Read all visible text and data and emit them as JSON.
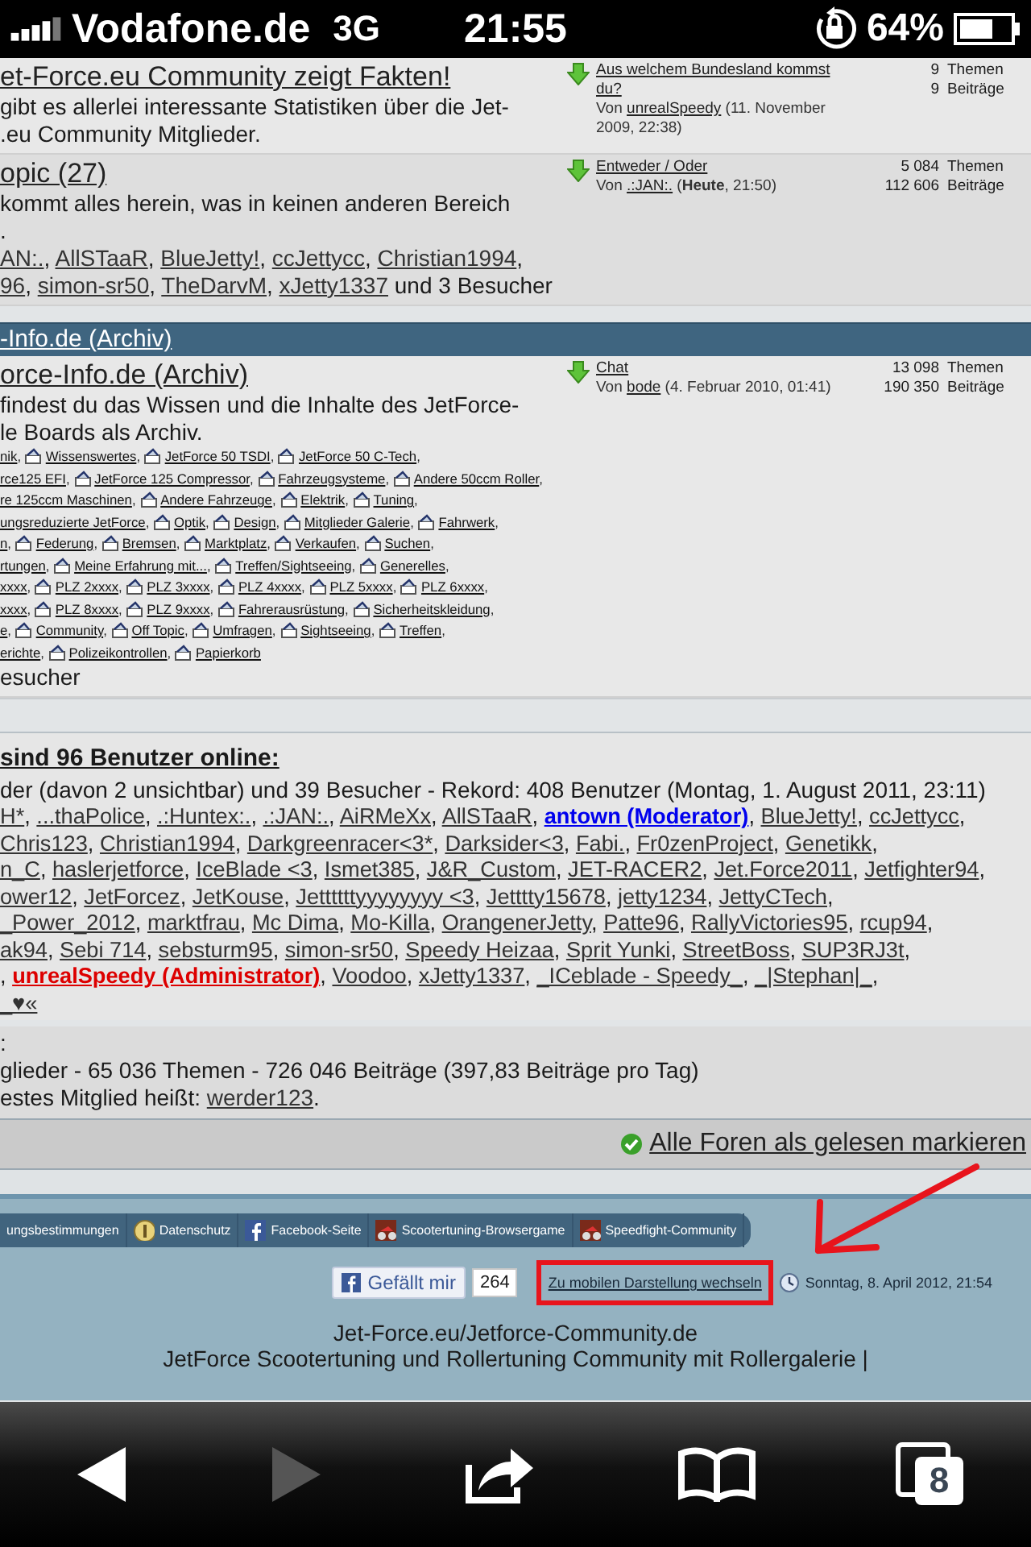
{
  "status_bar": {
    "carrier": "Vodafone.de",
    "network": "3G",
    "time": "21:55",
    "battery": "64%"
  },
  "forums_top": [
    {
      "title": "et-Force.eu Community zeigt Fakten!",
      "desc_lines": [
        "gibt es allerlei interessante Statistiken über die Jet-",
        ".eu Community Mitglieder."
      ],
      "last_post": {
        "title": "Aus welchem Bundesland kommst du?",
        "prefix": "Von ",
        "author": "unrealSpeedy",
        "date": " (11. November 2009, 22:38)"
      },
      "stats": [
        {
          "count": "9",
          "unit": "Themen"
        },
        {
          "count": "9",
          "unit": "Beiträge"
        }
      ]
    },
    {
      "title": "opic (27)",
      "desc_lines": [
        "kommt alles herein, was in keinen anderen Bereich",
        "."
      ],
      "separator": ", ",
      "user_lines": [
        {
          "users": [
            "AN:.",
            "AllSTaaR",
            "BlueJetty!",
            "ccJettycc",
            "Christian1994"
          ],
          "trail": ","
        },
        {
          "users": [
            "96",
            "simon-sr50",
            "TheDarvM",
            "xJetty1337"
          ],
          "trail": " und 3 Besucher"
        }
      ],
      "last_post": {
        "title": "Entweder / Oder",
        "prefix": "Von ",
        "author": ".:JAN:.",
        "date": " (**Heute**, 21:50)"
      },
      "stats": [
        {
          "count": "5 084",
          "unit": "Themen"
        },
        {
          "count": "112 606",
          "unit": "Beiträge"
        }
      ]
    }
  ],
  "category": {
    "title": "-Info.de (Archiv)"
  },
  "forums_archive": [
    {
      "title": "orce-Info.de (Archiv)",
      "desc_lines": [
        "findest du das Wissen und die Inhalte des JetForce-",
        "le Boards als Archiv."
      ],
      "separator": ", ",
      "subforum_lines": [
        {
          "items": [
            "nik",
            "Wissenswertes",
            "JetForce 50 TSDI",
            "JetForce 50 C-Tech"
          ],
          "trail": ","
        },
        {
          "items": [
            "rce125 EFI",
            "JetForce 125 Compressor",
            "Fahrzeugsysteme",
            "Andere 50ccm Roller"
          ],
          "trail": ","
        },
        {
          "items": [
            "re 125ccm Maschinen",
            "Andere Fahrzeuge",
            "Elektrik",
            "Tuning"
          ],
          "trail": ","
        },
        {
          "items": [
            "ungsreduzierte JetForce",
            "Optik",
            "Design",
            "Mitglieder Galerie",
            "Fahrwerk"
          ],
          "trail": ","
        },
        {
          "items": [
            "n",
            "Federung",
            "Bremsen",
            "Marktplatz",
            "Verkaufen",
            "Suchen"
          ],
          "trail": ","
        },
        {
          "items": [
            "rtungen",
            "Meine Erfahrung mit...",
            "Treffen/Sightseeing",
            "Generelles"
          ],
          "trail": ","
        },
        {
          "items": [
            "xxxx",
            "PLZ 2xxxx",
            "PLZ 3xxxx",
            "PLZ 4xxxx",
            "PLZ 5xxxx",
            "PLZ 6xxxx"
          ],
          "trail": ","
        },
        {
          "items": [
            "xxxx",
            "PLZ 8xxxx",
            "PLZ 9xxxx",
            "Fahrerausrüstung",
            "Sicherheitskleidung"
          ],
          "trail": ","
        },
        {
          "items": [
            "e",
            "Community",
            "Off Topic",
            "Umfragen",
            "Sightseeing",
            "Treffen"
          ],
          "trail": ","
        },
        {
          "items": [
            "erichte",
            "Polizeikontrollen",
            "Papierkorb"
          ]
        }
      ],
      "visitors": "esucher",
      "last_post": {
        "title": "Chat",
        "prefix": "Von ",
        "author": "bode",
        "date": " (4. Februar 2010, 01:41)"
      },
      "stats": [
        {
          "count": "13 098",
          "unit": "Themen"
        },
        {
          "count": "190 350",
          "unit": "Beiträge"
        }
      ]
    }
  ],
  "online": {
    "title": "sind 96 Benutzer online:",
    "summary": "der (davon 2 unsichtbar) und 39 Besucher - Rekord: 408 Benutzer (Montag, 1. August 2011, 23:11)",
    "separator": ", ",
    "lines": [
      {
        "users": [
          {
            "name": "H*",
            "kind": "member"
          },
          {
            "name": "...thaPolice",
            "kind": "member"
          },
          {
            "name": ".:Huntex:.",
            "kind": "member"
          },
          {
            "name": ".:JAN:.",
            "kind": "member"
          },
          {
            "name": "AiRMeXx",
            "kind": "member"
          },
          {
            "name": "AllSTaaR",
            "kind": "member"
          },
          {
            "name": "antown (Moderator)",
            "kind": "moderator"
          },
          {
            "name": "BlueJetty!",
            "kind": "member"
          },
          {
            "name": "ccJettycc",
            "kind": "member"
          }
        ],
        "trail": ","
      },
      {
        "users": [
          {
            "name": "Chris123",
            "kind": "member"
          },
          {
            "name": "Christian1994",
            "kind": "member"
          },
          {
            "name": "Darkgreenracer<3*",
            "kind": "member"
          },
          {
            "name": "Darksider<3",
            "kind": "member"
          },
          {
            "name": "Fabi.",
            "kind": "member"
          },
          {
            "name": "Fr0zenProject",
            "kind": "member"
          },
          {
            "name": "Genetikk",
            "kind": "member"
          }
        ],
        "trail": ","
      },
      {
        "users": [
          {
            "name": "n_C",
            "kind": "member"
          },
          {
            "name": "haslerjetforce",
            "kind": "member"
          },
          {
            "name": "IceBlade <3",
            "kind": "member"
          },
          {
            "name": "Ismet385",
            "kind": "member"
          },
          {
            "name": "J&R_Custom",
            "kind": "member"
          },
          {
            "name": "JET-RACER2",
            "kind": "member"
          },
          {
            "name": "Jet.Force2011",
            "kind": "member"
          },
          {
            "name": "Jetfighter94",
            "kind": "member"
          }
        ],
        "trail": ","
      },
      {
        "users": [
          {
            "name": "ower12",
            "kind": "member"
          },
          {
            "name": "JetForcez",
            "kind": "member"
          },
          {
            "name": "JetKouse",
            "kind": "member"
          },
          {
            "name": "Jettttttyyyyyyyy <3",
            "kind": "member"
          },
          {
            "name": "Jetttty15678",
            "kind": "member"
          },
          {
            "name": "jetty1234",
            "kind": "member"
          },
          {
            "name": "JettyCTech",
            "kind": "member"
          }
        ],
        "trail": ","
      },
      {
        "users": [
          {
            "name": "_Power_2012",
            "kind": "member"
          },
          {
            "name": "marktfrau",
            "kind": "member"
          },
          {
            "name": "Mc Dima",
            "kind": "member"
          },
          {
            "name": "Mo-Killa",
            "kind": "member"
          },
          {
            "name": "OrangenerJetty",
            "kind": "member"
          },
          {
            "name": "Patte96",
            "kind": "member"
          },
          {
            "name": "RallyVictories95",
            "kind": "member"
          },
          {
            "name": "rcup94",
            "kind": "member"
          }
        ],
        "trail": ","
      },
      {
        "users": [
          {
            "name": "ak94",
            "kind": "member"
          },
          {
            "name": "Sebi 714",
            "kind": "member"
          },
          {
            "name": "sebsturm95",
            "kind": "member"
          },
          {
            "name": "simon-sr50",
            "kind": "member"
          },
          {
            "name": "Speedy Heizaa",
            "kind": "member"
          },
          {
            "name": "Sprit Yunki",
            "kind": "member"
          },
          {
            "name": "StreetBoss",
            "kind": "member"
          },
          {
            "name": "SUP3RJ3t",
            "kind": "member"
          }
        ],
        "trail": ","
      },
      {
        "lead": ", ",
        "users": [
          {
            "name": "unrealSpeedy (Administrator)",
            "kind": "administrator"
          },
          {
            "name": "Voodoo",
            "kind": "member"
          },
          {
            "name": "xJetty1337",
            "kind": "member"
          },
          {
            "name": "_ICeblade - Speedy_",
            "kind": "member"
          },
          {
            "name": "_|Stephan|_",
            "kind": "member"
          }
        ],
        "trail": ","
      },
      {
        "users": [
          {
            "name": "_♥«",
            "kind": "member"
          }
        ]
      }
    ]
  },
  "statistics": {
    "heading": ":",
    "totals": "glieder - 65 036 Themen - 726 046 Beiträge (397,83 Beiträge pro Tag)",
    "newest_prefix": "estes Mitglied heißt: ",
    "newest_user": "werder123",
    "newest_suffix": "."
  },
  "mark_read": {
    "label": "Alle Foren als gelesen markieren"
  },
  "footer": {
    "nav": [
      {
        "label": "ungsbestimmungen",
        "kind": "plain"
      },
      {
        "label": "Datenschutz",
        "kind": "coin"
      },
      {
        "label": "Facebook-Seite",
        "kind": "facebook"
      },
      {
        "label": "Scootertuning-Browsergame",
        "kind": "scooter"
      },
      {
        "label": "Speedfight-Community",
        "kind": "scooter"
      }
    ],
    "like": {
      "label": "Gefällt mir",
      "count": "264"
    },
    "mobile_link": {
      "label": "Zu mobilen Darstellung wechseln",
      "highlighted": true
    },
    "datetime": "Sonntag, 8. April 2012, 21:54",
    "site_lines": [
      "Jet-Force.eu/Jetforce-Community.de",
      "JetForce Scootertuning und Rollertuning Community mit Rollergalerie |"
    ]
  },
  "toolbar": {
    "back_enabled": true,
    "forward_enabled": false,
    "tab_count": "8"
  }
}
